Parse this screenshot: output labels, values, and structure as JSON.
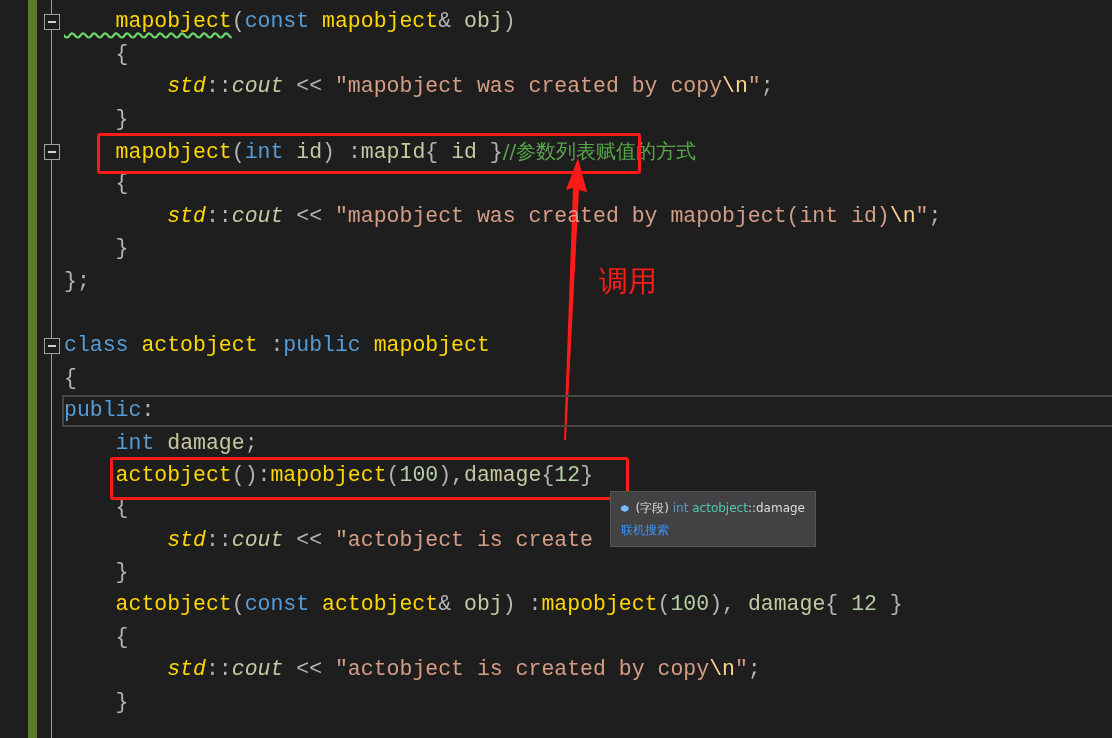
{
  "editor": {
    "lines": [
      {
        "fold": true,
        "current": false,
        "tokens": [
          {
            "kind": "fnw",
            "t": "    mapobject"
          },
          {
            "kind": "p",
            "t": "("
          },
          {
            "kind": "kw",
            "t": "const"
          },
          {
            "kind": "fn",
            "t": " mapobject"
          },
          {
            "kind": "p",
            "t": "& "
          },
          {
            "kind": "par",
            "t": "obj"
          },
          {
            "kind": "p",
            "t": ")"
          }
        ]
      },
      {
        "fold": false,
        "current": false,
        "tokens": [
          {
            "kind": "p",
            "t": "    {"
          }
        ]
      },
      {
        "fold": false,
        "current": false,
        "tokens": [
          {
            "kind": "ns",
            "t": "        std"
          },
          {
            "kind": "p",
            "t": "::"
          },
          {
            "kind": "mem",
            "t": "cout"
          },
          {
            "kind": "p",
            "t": " << "
          },
          {
            "kind": "str",
            "t": "\"mapobject was created by copy"
          },
          {
            "kind": "esc",
            "t": "\\n"
          },
          {
            "kind": "str",
            "t": "\""
          },
          {
            "kind": "p",
            "t": ";"
          }
        ]
      },
      {
        "fold": false,
        "current": false,
        "tokens": [
          {
            "kind": "p",
            "t": "    }"
          }
        ]
      },
      {
        "fold": true,
        "current": false,
        "tokens": [
          {
            "kind": "fn",
            "t": "    mapobject"
          },
          {
            "kind": "p",
            "t": "("
          },
          {
            "kind": "kw",
            "t": "int"
          },
          {
            "kind": "par",
            "t": " id"
          },
          {
            "kind": "p",
            "t": ") :"
          },
          {
            "kind": "mem",
            "t": "mapId"
          },
          {
            "kind": "p",
            "t": "{ "
          },
          {
            "kind": "par",
            "t": "id"
          },
          {
            "kind": "p",
            "t": " }"
          },
          {
            "kind": "cm",
            "t": "//参数列表赋值的方式"
          }
        ]
      },
      {
        "fold": false,
        "current": false,
        "tokens": [
          {
            "kind": "p",
            "t": "    {"
          }
        ]
      },
      {
        "fold": false,
        "current": false,
        "tokens": [
          {
            "kind": "ns",
            "t": "        std"
          },
          {
            "kind": "p",
            "t": "::"
          },
          {
            "kind": "mem",
            "t": "cout"
          },
          {
            "kind": "p",
            "t": " << "
          },
          {
            "kind": "str",
            "t": "\"mapobject was created by mapobject(int id)"
          },
          {
            "kind": "esc",
            "t": "\\n"
          },
          {
            "kind": "str",
            "t": "\""
          },
          {
            "kind": "p",
            "t": ";"
          }
        ]
      },
      {
        "fold": false,
        "current": false,
        "tokens": [
          {
            "kind": "p",
            "t": "    }"
          }
        ]
      },
      {
        "fold": false,
        "current": false,
        "tokens": [
          {
            "kind": "p",
            "t": "};"
          }
        ]
      },
      {
        "fold": false,
        "current": false
      },
      {
        "fold": true,
        "current": false,
        "tokens": [
          {
            "kind": "kw",
            "t": "class"
          },
          {
            "kind": "fn",
            "t": " actobject"
          },
          {
            "kind": "p",
            "t": " :"
          },
          {
            "kind": "kw",
            "t": "public"
          },
          {
            "kind": "fn",
            "t": " mapobject"
          }
        ]
      },
      {
        "fold": false,
        "current": false,
        "tokens": [
          {
            "kind": "p",
            "t": "{"
          }
        ]
      },
      {
        "fold": false,
        "current": true,
        "tokens": [
          {
            "kind": "kw",
            "t": "public"
          },
          {
            "kind": "p",
            "t": ":"
          }
        ]
      },
      {
        "fold": false,
        "current": false,
        "tokens": [
          {
            "kind": "kw",
            "t": "    int"
          },
          {
            "kind": "mem",
            "t": " damage"
          },
          {
            "kind": "p",
            "t": ";"
          }
        ]
      },
      {
        "fold": false,
        "current": false,
        "tokens": [
          {
            "kind": "fn",
            "t": "    actobject"
          },
          {
            "kind": "p",
            "t": "():"
          },
          {
            "kind": "fn",
            "t": "mapobject"
          },
          {
            "kind": "p",
            "t": "("
          },
          {
            "kind": "num",
            "t": "100"
          },
          {
            "kind": "p",
            "t": "),"
          },
          {
            "kind": "mem",
            "t": "damage"
          },
          {
            "kind": "p",
            "t": "{"
          },
          {
            "kind": "num",
            "t": "12"
          },
          {
            "kind": "p",
            "t": "}"
          }
        ]
      },
      {
        "fold": false,
        "current": false,
        "tokens": [
          {
            "kind": "p",
            "t": "    {"
          }
        ]
      },
      {
        "fold": false,
        "current": false,
        "tokens": [
          {
            "kind": "ns",
            "t": "        std"
          },
          {
            "kind": "p",
            "t": "::"
          },
          {
            "kind": "mem",
            "t": "cout"
          },
          {
            "kind": "p",
            "t": " << "
          },
          {
            "kind": "str",
            "t": "\"actobject is create"
          }
        ]
      },
      {
        "fold": false,
        "current": false,
        "tokens": [
          {
            "kind": "p",
            "t": "    }"
          }
        ]
      },
      {
        "fold": false,
        "current": false,
        "tokens": [
          {
            "kind": "fn",
            "t": "    actobject"
          },
          {
            "kind": "p",
            "t": "("
          },
          {
            "kind": "kw",
            "t": "const"
          },
          {
            "kind": "fn",
            "t": " actobject"
          },
          {
            "kind": "p",
            "t": "& "
          },
          {
            "kind": "par",
            "t": "obj"
          },
          {
            "kind": "p",
            "t": ") :"
          },
          {
            "kind": "fn",
            "t": "mapobject"
          },
          {
            "kind": "p",
            "t": "("
          },
          {
            "kind": "num",
            "t": "100"
          },
          {
            "kind": "p",
            "t": "), "
          },
          {
            "kind": "mem",
            "t": "damage"
          },
          {
            "kind": "p",
            "t": "{ "
          },
          {
            "kind": "num",
            "t": "12"
          },
          {
            "kind": "p",
            "t": " }"
          }
        ]
      },
      {
        "fold": false,
        "current": false,
        "tokens": [
          {
            "kind": "p",
            "t": "    {"
          }
        ]
      },
      {
        "fold": false,
        "current": false,
        "tokens": [
          {
            "kind": "ns",
            "t": "        std"
          },
          {
            "kind": "p",
            "t": "::"
          },
          {
            "kind": "mem",
            "t": "cout"
          },
          {
            "kind": "p",
            "t": " << "
          },
          {
            "kind": "str",
            "t": "\"actobject is created by copy"
          },
          {
            "kind": "esc",
            "t": "\\n"
          },
          {
            "kind": "str",
            "t": "\""
          },
          {
            "kind": "p",
            "t": ";"
          }
        ]
      },
      {
        "fold": false,
        "current": false,
        "tokens": [
          {
            "kind": "p",
            "t": "    }"
          }
        ]
      }
    ]
  },
  "tooltip": {
    "category": "(字段)",
    "type": "int",
    "owner": "actobject",
    "separator": "::",
    "member": "damage",
    "link": "联机搜索"
  },
  "annotation": {
    "label": "调用"
  }
}
